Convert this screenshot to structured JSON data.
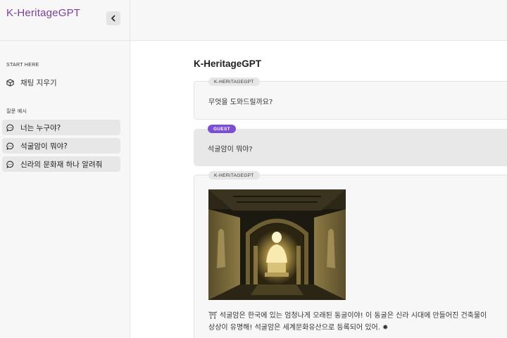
{
  "app": {
    "brand": "K-HeritageGPT",
    "collapse_icon": "chevron-left-icon"
  },
  "sidebar": {
    "start_label": "START HERE",
    "clear_chat": {
      "label": "채팅 지우기",
      "icon": "cube-icon"
    },
    "examples_label": "질문 예시",
    "examples": [
      {
        "label": "너는 누구야?",
        "icon": "chat-bubble-icon"
      },
      {
        "label": "석굴암이 뭐야?",
        "icon": "chat-bubble-icon"
      },
      {
        "label": "신라의 문화재 하나 알려줘",
        "icon": "chat-bubble-icon"
      }
    ]
  },
  "main": {
    "title": "K-HeritageGPT",
    "messages": [
      {
        "role": "bot",
        "badge": "K-HERITAGEGPT",
        "text": "무엇을 도와드릴까요?"
      },
      {
        "role": "user",
        "badge": "GUEST",
        "text": "석굴암이 뭐야?"
      },
      {
        "role": "bot",
        "badge": "K-HERITAGEGPT",
        "image": "seokguram-grotto-photo",
        "lines": [
          "⛩ 석굴암은 한국에 있는 엄청나게 오래된 동굴이야! 이 동굴은 신라 시대에 만들어진 건축물이",
          "상상이 유명해! 석굴암은 세계문화유산으로 등록되어 있어. ✸"
        ]
      }
    ]
  },
  "colors": {
    "brand": "#7b3fa0",
    "guest_badge": "#7c4dd6"
  }
}
